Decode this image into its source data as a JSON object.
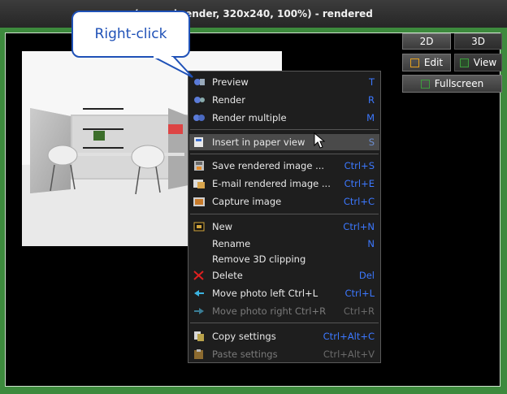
{
  "window": {
    "title": "(normal render, 320x240, 100%) - rendered"
  },
  "callout": {
    "text": "Right-click"
  },
  "toolbar": {
    "view_2d": "2D",
    "view_3d": "3D",
    "edit": "Edit",
    "view": "View",
    "fullscreen": "Fullscreen"
  },
  "menu": {
    "items": [
      {
        "label": "Preview",
        "shortcut": "T",
        "icon": "preview-icon",
        "disabled": false
      },
      {
        "label": "Render",
        "shortcut": "R",
        "icon": "render-icon",
        "disabled": false
      },
      {
        "label": "Render multiple",
        "shortcut": "M",
        "icon": "render-multiple-icon",
        "disabled": false
      },
      {
        "label": "Insert in paper view",
        "shortcut": "S",
        "icon": "paper-view-icon",
        "disabled": false,
        "highlighted": true
      },
      {
        "label": "Save rendered image ...",
        "shortcut": "Ctrl+S",
        "icon": "save-icon",
        "disabled": false
      },
      {
        "label": "E-mail rendered image ...",
        "shortcut": "Ctrl+E",
        "icon": "email-icon",
        "disabled": false
      },
      {
        "label": "Capture image",
        "shortcut": "Ctrl+C",
        "icon": "capture-icon",
        "disabled": false
      },
      {
        "label": "New",
        "shortcut": "Ctrl+N",
        "icon": "new-icon",
        "disabled": false
      },
      {
        "label": "Rename",
        "shortcut": "N",
        "icon": "",
        "disabled": false
      },
      {
        "label": "Remove 3D clipping",
        "shortcut": "",
        "icon": "",
        "disabled": false
      },
      {
        "label": "Delete",
        "shortcut": "Del",
        "icon": "delete-icon",
        "disabled": false
      },
      {
        "label": "Move photo left Ctrl+L",
        "shortcut": "Ctrl+L",
        "icon": "move-left-icon",
        "disabled": false
      },
      {
        "label": "Move photo right Ctrl+R",
        "shortcut": "Ctrl+R",
        "icon": "move-right-icon",
        "disabled": true
      },
      {
        "label": "Copy settings",
        "shortcut": "Ctrl+Alt+C",
        "icon": "copy-icon",
        "disabled": false
      },
      {
        "label": "Paste settings",
        "shortcut": "Ctrl+Alt+V",
        "icon": "paste-icon",
        "disabled": true
      }
    ]
  },
  "colors": {
    "frame_green": "#3d8a3d",
    "shortcut_blue": "#3c78ff",
    "callout_blue": "#1f51b7"
  }
}
